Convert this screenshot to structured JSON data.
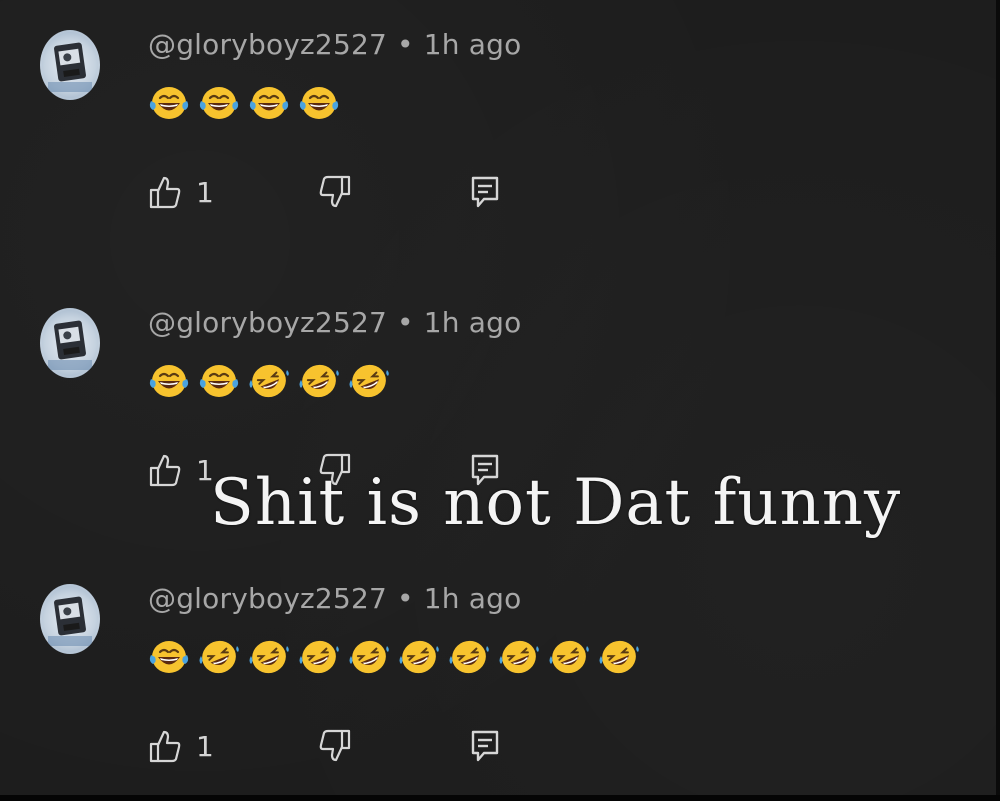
{
  "comments": [
    {
      "username": "@gloryboyz2527",
      "separator": "•",
      "time": "1h ago",
      "emojis": [
        "laugh-cry",
        "laugh-cry",
        "laugh-cry",
        "laugh-cry"
      ],
      "like_count": "1"
    },
    {
      "username": "@gloryboyz2527",
      "separator": "•",
      "time": "1h ago",
      "emojis": [
        "laugh-cry",
        "laugh-cry",
        "rofl",
        "rofl",
        "rofl"
      ],
      "like_count": "1"
    },
    {
      "username": "@gloryboyz2527",
      "separator": "•",
      "time": "1h ago",
      "emojis": [
        "laugh-cry",
        "rofl",
        "rofl",
        "rofl",
        "rofl",
        "rofl",
        "rofl",
        "rofl",
        "rofl",
        "rofl"
      ],
      "like_count": "1"
    }
  ],
  "caption": "Shit is not Dat funny",
  "icons": {
    "like": "thumbs-up-icon",
    "dislike": "thumbs-down-icon",
    "reply": "reply-comment-icon"
  },
  "colors": {
    "background": "#1d1d1d",
    "meta_text": "#a7a7a7",
    "icon": "#d6d6d6",
    "caption": "#f4f4f4",
    "emoji_face": "#f7c32e",
    "emoji_tear": "#4aa3df"
  }
}
